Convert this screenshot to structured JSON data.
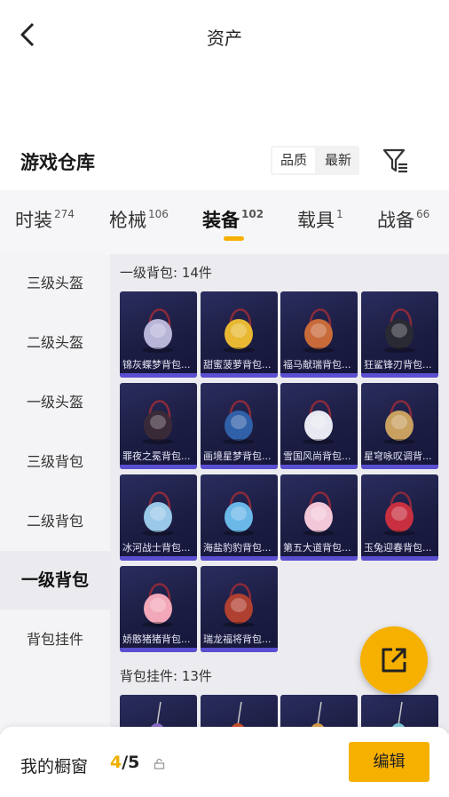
{
  "header": {
    "title": "资产"
  },
  "section": {
    "title": "游戏仓库",
    "sort_options": [
      "品质",
      "最新"
    ]
  },
  "tabs": [
    {
      "label": "时装",
      "count": "274"
    },
    {
      "label": "枪械",
      "count": "106"
    },
    {
      "label": "装备",
      "count": "102"
    },
    {
      "label": "载具",
      "count": "1"
    },
    {
      "label": "战备",
      "count": "66"
    }
  ],
  "sidebar": [
    "三级头盔",
    "二级头盔",
    "一级头盔",
    "三级背包",
    "二级背包",
    "一级背包",
    "背包挂件"
  ],
  "groups": [
    {
      "title": "一级背包: 14件",
      "items": [
        "锦灰蝶梦背包...",
        "甜蜜菠萝背包...",
        "福马献瑞背包...",
        "狂鲨锋刃背包...",
        "罪夜之冕背包...",
        "画境星梦背包...",
        "雪国风尚背包...",
        "星穹咏叹调背...",
        "冰河战士背包...",
        "海盐豹豹背包...",
        "第五大道背包...",
        "玉兔迎春背包...",
        "娇憨猪猪背包...",
        "瑞龙福将背包..."
      ]
    },
    {
      "title": "背包挂件: 13件"
    }
  ],
  "bottom": {
    "label": "我的橱窗",
    "current": "4",
    "total": "/5",
    "edit_label": "编辑"
  },
  "colors": {
    "accent": "#f6b000",
    "card_bg": "#1f2148",
    "card_bar": "#5a4fd0"
  },
  "icons": [
    "back-arrow-icon",
    "filter-icon",
    "share-icon",
    "lock-icon"
  ]
}
